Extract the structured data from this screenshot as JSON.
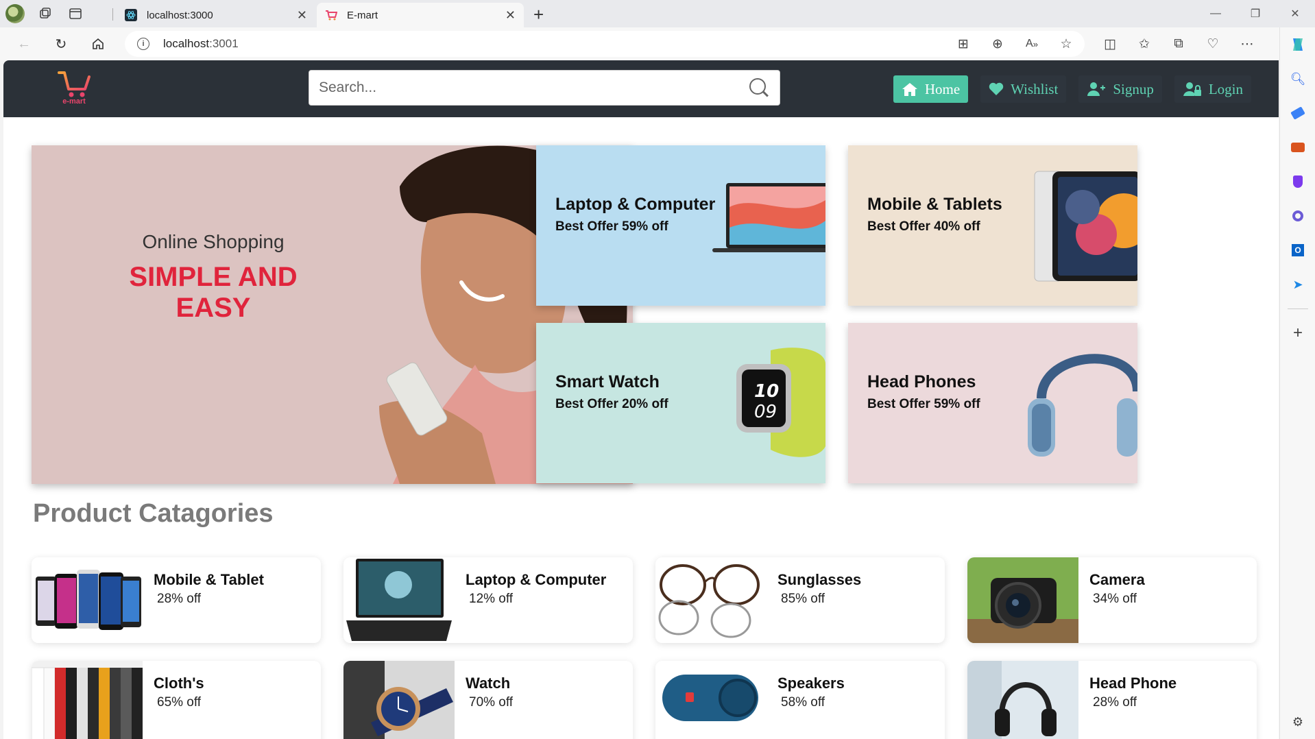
{
  "browser": {
    "tabs": [
      {
        "title": "localhost:3000"
      },
      {
        "title": "E-mart"
      }
    ],
    "url_host": "localhost",
    "url_port": ":3001"
  },
  "site": {
    "logo_text": "e-mart",
    "search_placeholder": "Search...",
    "nav": [
      {
        "label": "Home",
        "icon": "home-icon"
      },
      {
        "label": "Wishlist",
        "icon": "heart-icon"
      },
      {
        "label": "Signup",
        "icon": "user-plus-icon"
      },
      {
        "label": "Login",
        "icon": "user-lock-icon"
      }
    ]
  },
  "hero": {
    "subtitle": "Online Shopping",
    "headline": "SIMPLE AND EASY"
  },
  "offers": [
    {
      "title": "Laptop & Computer",
      "offer": "Best Offer 59% off",
      "bg": "#b9ddf1"
    },
    {
      "title": "Mobile & Tablets",
      "offer": "Best Offer 40% off",
      "bg": "#efe2d2"
    },
    {
      "title": "Smart Watch",
      "offer": "Best Offer 20% off",
      "bg": "#c6e6e1"
    },
    {
      "title": "Head Phones",
      "offer": "Best Offer 59% off",
      "bg": "#ecd9db"
    }
  ],
  "categories_title": "Product Catagories",
  "categories": [
    {
      "name": "Mobile & Tablet",
      "discount": "28% off"
    },
    {
      "name": "Laptop & Computer",
      "discount": "12% off"
    },
    {
      "name": "Sunglasses",
      "discount": "85% off"
    },
    {
      "name": "Camera",
      "discount": "34% off"
    },
    {
      "name": "Cloth's",
      "discount": "65% off"
    },
    {
      "name": "Watch",
      "discount": "70% off"
    },
    {
      "name": "Speakers",
      "discount": "58% off"
    },
    {
      "name": "Head Phone",
      "discount": "28% off"
    }
  ],
  "colors": {
    "nav_bg": "#2b3138",
    "accent": "#4cc4a3",
    "headline_red": "#e0243c"
  }
}
